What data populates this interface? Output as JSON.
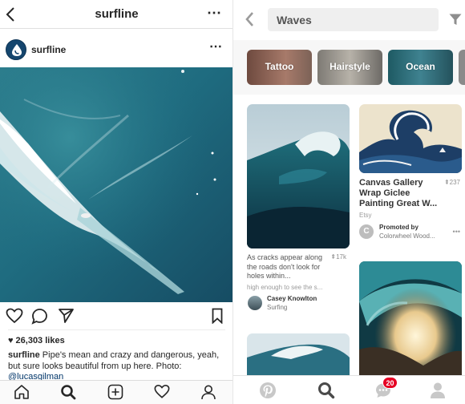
{
  "instagram": {
    "top_bar": {
      "title": "surfline"
    },
    "post_header": {
      "username": "surfline"
    },
    "likes": "26,303 likes",
    "caption": {
      "username": "surfline",
      "text": "Pipe's mean and crazy and dangerous, yeah, but sure looks beautiful from up here. Photo:",
      "mention": "@lucasgilman"
    }
  },
  "pinterest": {
    "search": {
      "value": "Waves"
    },
    "chips": [
      {
        "label": "Tattoo"
      },
      {
        "label": "Hairstyle"
      },
      {
        "label": "Ocean"
      }
    ],
    "pins": [
      {
        "description": "As cracks appear along the roads don't look for holes within...",
        "saves": "17k",
        "more": "high enough to see the s...",
        "author": "Casey Knowlton",
        "board": "Surfing"
      },
      {
        "title": "Canvas Gallery Wrap Giclee Painting Great W...",
        "saves": "237",
        "source": "Etsy",
        "promoted_label": "Promoted by",
        "promoter": "Colorwheel Wood...",
        "promoter_initial": "C"
      }
    ],
    "notifications_badge": "20"
  },
  "colors": {
    "pinterest_red": "#e60023",
    "instagram_text": "#262626",
    "mention": "#003569"
  }
}
